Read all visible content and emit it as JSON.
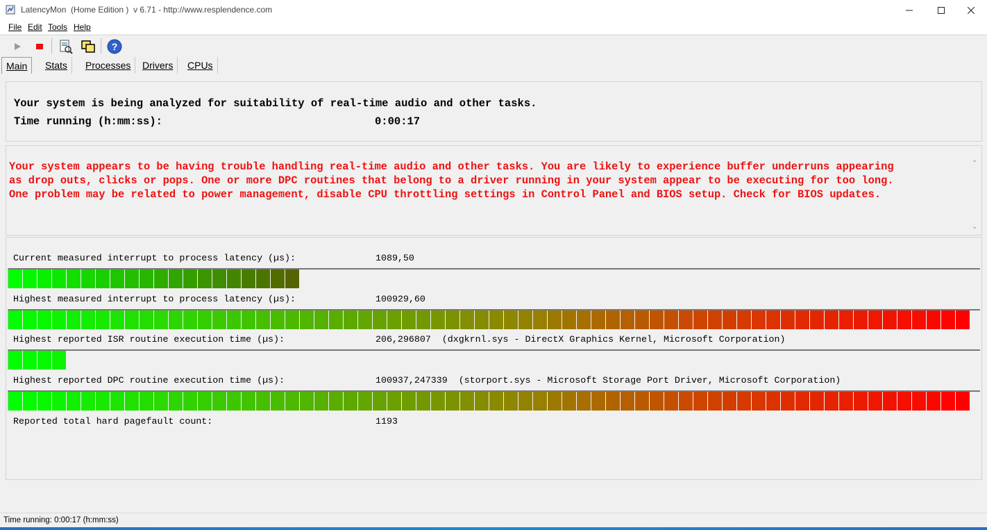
{
  "window": {
    "title": "LatencyMon  (Home Edition )  v 6.71 - http://www.resplendence.com"
  },
  "menu": [
    {
      "label": "File"
    },
    {
      "label": "Edit"
    },
    {
      "label": "Tools"
    },
    {
      "label": "Help"
    }
  ],
  "toolbar": {
    "icons": [
      "play-icon",
      "stop-icon",
      "report-icon",
      "windows-icon",
      "help-icon"
    ]
  },
  "tabs": [
    {
      "label": "Main",
      "active": true
    },
    {
      "label": "Stats"
    },
    {
      "label": "Processes"
    },
    {
      "label": "Drivers"
    },
    {
      "label": "CPUs"
    }
  ],
  "main": {
    "headline": "Your system is being analyzed for suitability of real-time audio and other tasks.",
    "time_label": "Time running (h:mm:ss):",
    "time_value": "0:00:17",
    "warning_lines": [
      "Your system appears to be having trouble handling real-time audio and other tasks. You are likely to experience buffer underruns appearing",
      "as drop outs, clicks or pops. One or more DPC routines that belong to a driver running in your system appear to be executing for too long.",
      "One problem may be related to power management, disable CPU throttling settings in Control Panel and BIOS setup. Check for BIOS updates."
    ],
    "warning_color": "#ee1111"
  },
  "metrics": [
    {
      "label": "Current measured interrupt to process latency (µs):",
      "value": "1089,50",
      "detail": "",
      "bar_fill": 0.31
    },
    {
      "label": "Highest measured interrupt to process latency (µs):",
      "value": "100929,60",
      "detail": "",
      "bar_fill": 1.0
    },
    {
      "label": "Highest reported ISR routine execution time (µs):",
      "value": "206,296807",
      "detail": "(dxgkrnl.sys - DirectX Graphics Kernel, Microsoft Corporation)",
      "bar_fill": 0.06
    },
    {
      "label": "Highest reported DPC routine execution time (µs):",
      "value": "100937,247339",
      "detail": "(storport.sys - Microsoft Storage Port Driver, Microsoft Corporation)",
      "bar_fill": 1.0
    },
    {
      "label": "Reported total hard pagefault count:",
      "value": "1193",
      "detail": ""
    }
  ],
  "status": {
    "text": "Time running: 0:00:17  (h:mm:ss)"
  }
}
